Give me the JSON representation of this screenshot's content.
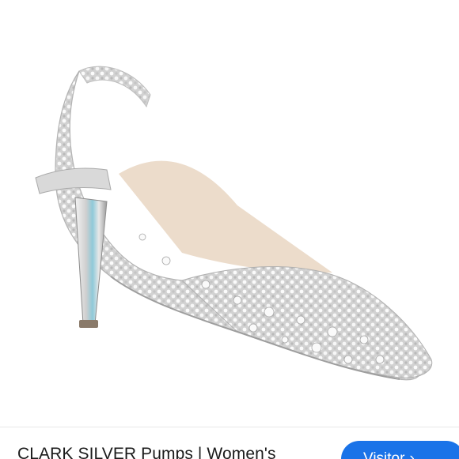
{
  "product": {
    "title": "CLARK SILVER Pumps | Women's",
    "image_alt": "silver-rhinestone-slingback-pump"
  },
  "actions": {
    "visitor_label": "Visitor",
    "visitor_icon": "chevron-right-icon"
  },
  "colors": {
    "accent": "#1a73e8",
    "background": "#ffffff",
    "title_text": "#1a1a1a"
  }
}
